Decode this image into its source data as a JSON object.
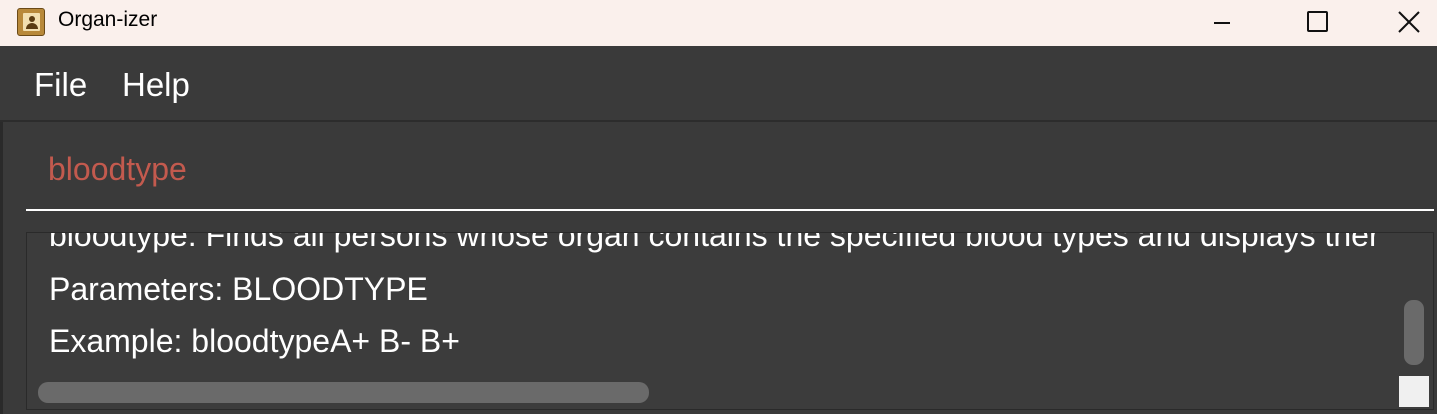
{
  "window": {
    "title": "Organ-izer",
    "app_icon": "address-book-icon",
    "controls": [
      "minimize-icon",
      "maximize-icon",
      "close-icon"
    ]
  },
  "menu": {
    "file_label": "File",
    "help_label": "Help"
  },
  "command_box": {
    "value": "bloodtype",
    "text_color": "#c35a4e"
  },
  "result_display": {
    "lines": [
      "bloodtype: Finds all persons whose organ contains the specified blood types and displays ther",
      "Parameters: BLOODTYPE",
      "Example: bloodtypeA+ B- B+"
    ]
  },
  "colors": {
    "background": "#3a3a3a",
    "titlebar": "#faf0ec",
    "text": "#ffffff"
  }
}
